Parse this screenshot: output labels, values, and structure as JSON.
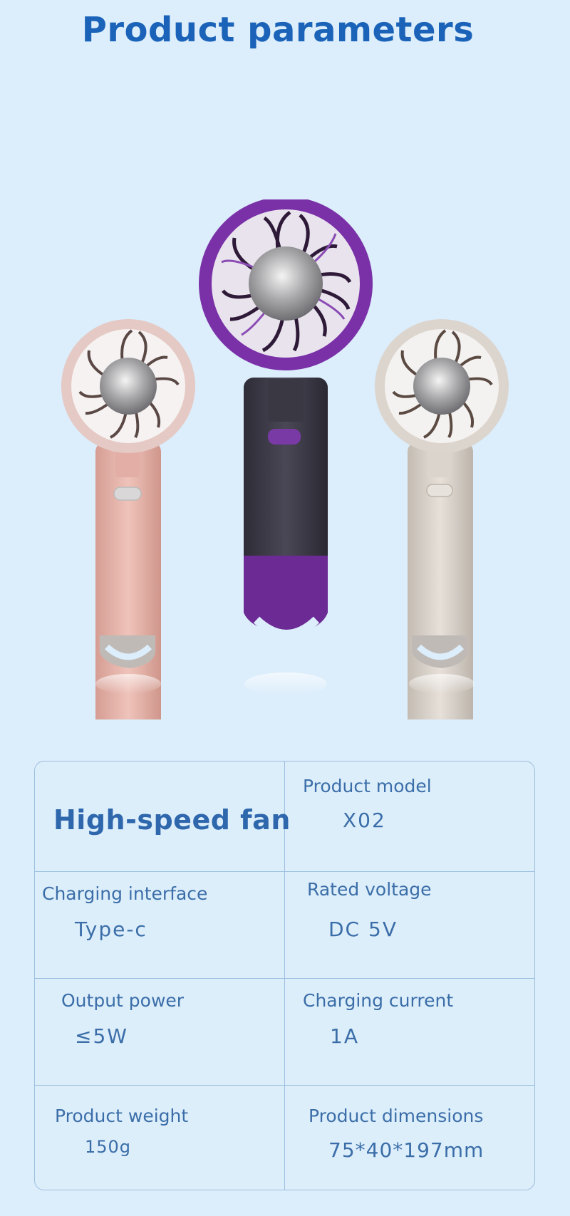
{
  "title": "Product parameters",
  "product_image": {
    "description": "three handheld fans",
    "colors": {
      "pink": "#e4b3aa",
      "purple": "#6e2a96",
      "dark_body": "#3e3c48",
      "beige": "#d6cfc7",
      "background": "#dcedfb",
      "accent_blue": "#1a63b8"
    }
  },
  "specs": {
    "highlight": "High-speed fan",
    "product_model_label": "Product model",
    "product_model_value": "X02",
    "charging_interface_label": "Charging interface",
    "charging_interface_value": "Type-c",
    "rated_voltage_label": "Rated voltage",
    "rated_voltage_value": "DC 5V",
    "output_power_label": "Output power",
    "output_power_value": "≤5W",
    "charging_current_label": "Charging current",
    "charging_current_value": "1A",
    "product_weight_label": "Product weight",
    "product_weight_value": "150g",
    "product_dimensions_label": "Product dimensions",
    "product_dimensions_value": "75*40*197mm"
  }
}
